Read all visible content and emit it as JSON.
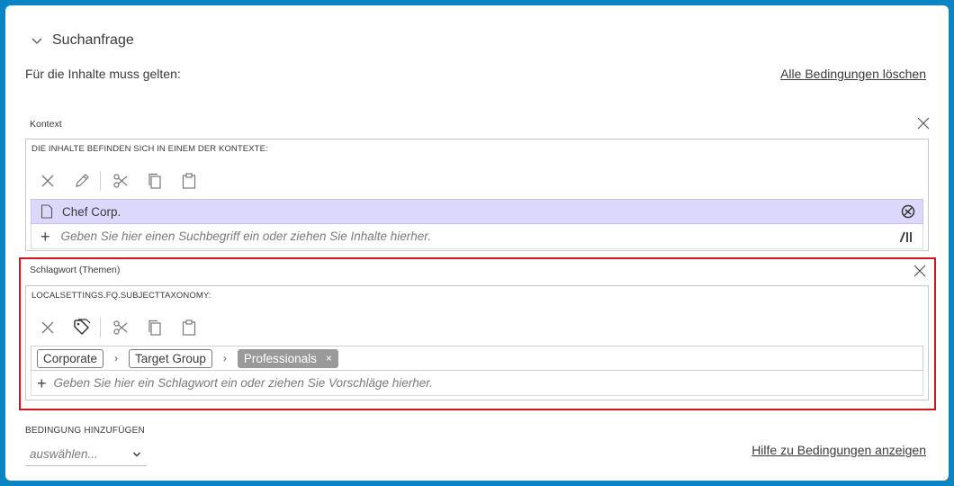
{
  "header": {
    "title": "Suchanfrage"
  },
  "intro_text": "Für die Inhalte muss gelten:",
  "clear_all_link": "Alle Bedingungen löschen",
  "conditions": [
    {
      "title": "Kontext",
      "caption": "DIE INHALTE BEFINDEN SICH IN EINEM DER KONTEXTE:",
      "items": [
        {
          "name": "Chef Corp.",
          "icon": "document-icon"
        }
      ],
      "placeholder": "Geben Sie hier einen Suchbegriff ein oder ziehen Sie Inhalte hierher.",
      "toolbar": [
        "remove-icon",
        "edit-icon",
        "cut-icon",
        "copy-icon",
        "paste-icon"
      ]
    },
    {
      "title": "Schlagwort (Themen)",
      "caption": "LOCALSETTINGS.FQ.SUBJECTTAXONOMY:",
      "path": [
        "Corporate",
        "Target Group"
      ],
      "selected_tag": "Professionals",
      "selected_tag_remove": "×",
      "placeholder": "Geben Sie hier ein Schlagwort ein oder ziehen Sie Vorschläge hierher.",
      "toolbar": [
        "remove-icon",
        "tag-icon",
        "cut-icon",
        "copy-icon",
        "paste-icon"
      ]
    }
  ],
  "add_condition": {
    "title": "BEDINGUNG HINZUFÜGEN",
    "select_value": "auswählen..."
  },
  "help_link": "Hilfe zu Bedingungen anzeigen",
  "colors": {
    "frame": "#0b84c4",
    "highlight_border": "#d0161c",
    "selected_row": "#dcd8fb",
    "active_chip": "#9a9a9a"
  }
}
